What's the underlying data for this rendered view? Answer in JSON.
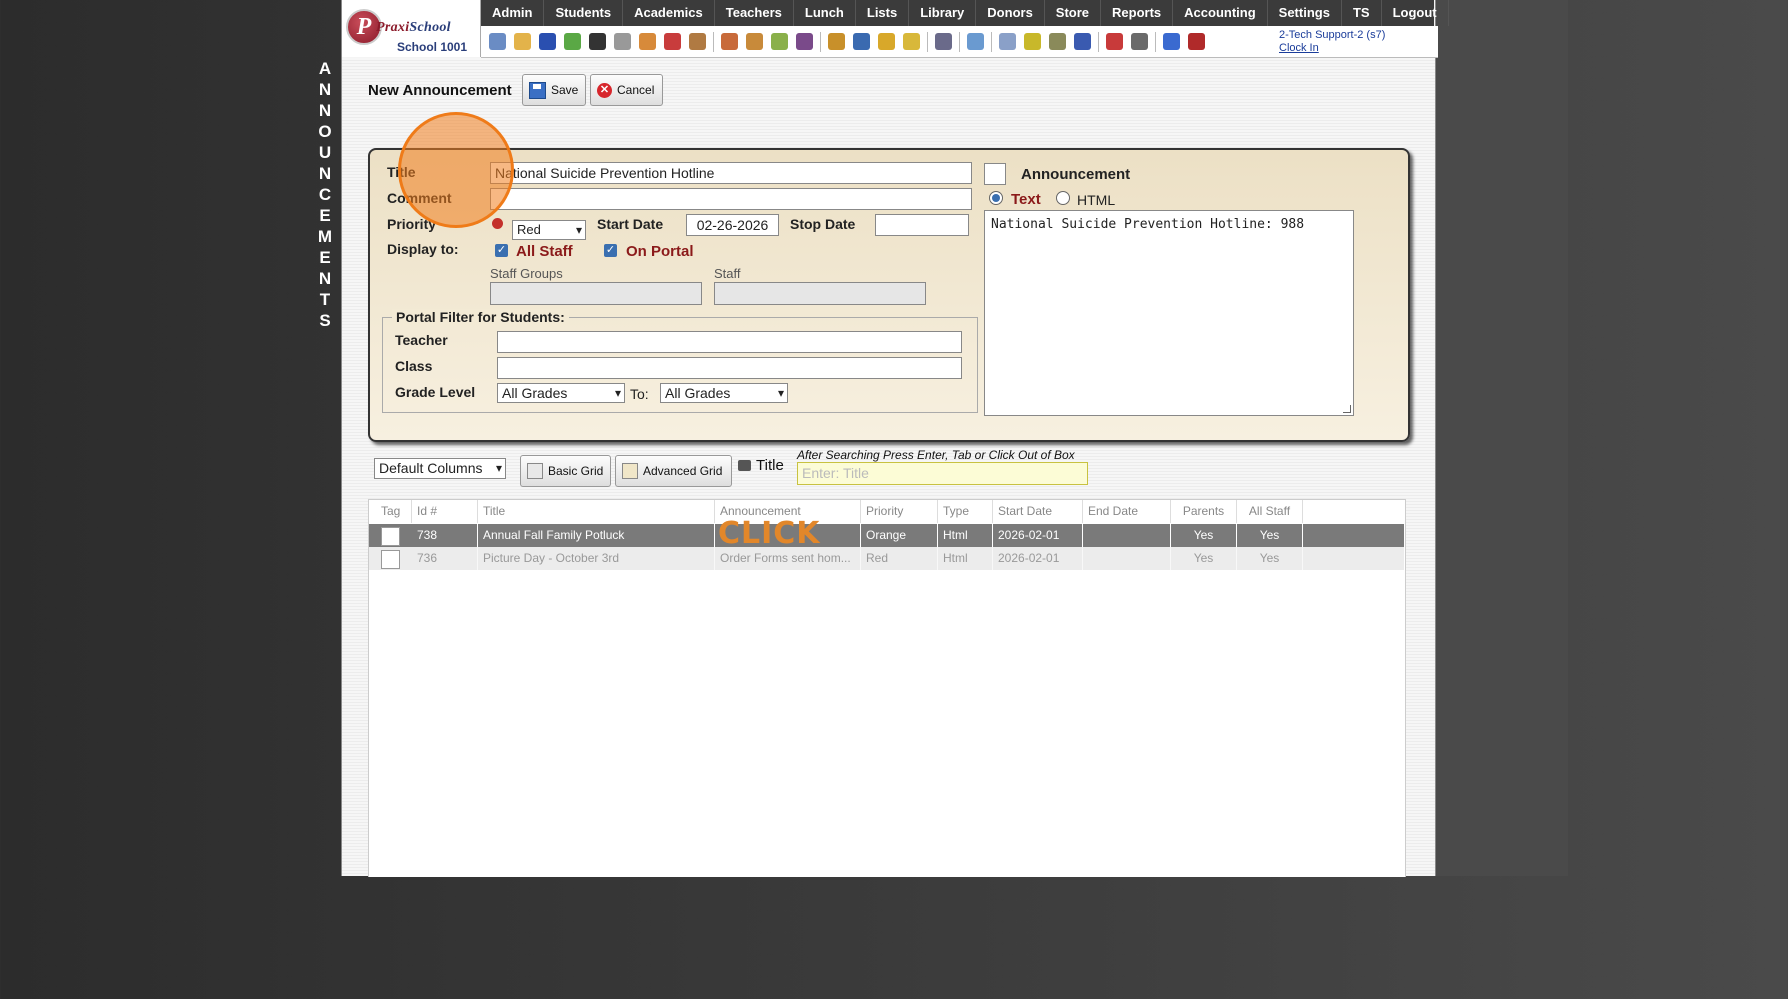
{
  "side_title": [
    "A",
    "N",
    "N",
    "O",
    "U",
    "N",
    "C",
    "E",
    "M",
    "E",
    "N",
    "T",
    "S"
  ],
  "logo": {
    "brand_main": "Praxi",
    "brand_sub": "School",
    "school": "School 1001"
  },
  "menu": [
    "Admin",
    "Students",
    "Academics",
    "Teachers",
    "Lunch",
    "Lists",
    "Library",
    "Donors",
    "Store",
    "Reports",
    "Accounting",
    "Settings",
    "TS",
    "Logout"
  ],
  "toolbar_icons": [
    {
      "name": "search-icon",
      "color": "#6a8cc4"
    },
    {
      "name": "calendar-grid-icon",
      "color": "#e3b34a"
    },
    {
      "name": "email-icon",
      "color": "#2a4fb0"
    },
    {
      "name": "chat-icon",
      "color": "#5aa845"
    },
    {
      "name": "mobile-icon",
      "color": "#333333"
    },
    {
      "name": "speaker-icon",
      "color": "#999999"
    },
    {
      "name": "schedule-icon",
      "color": "#d78a3a"
    },
    {
      "name": "calendar-icon",
      "color": "#c83c3c"
    },
    {
      "name": "megaphone-icon",
      "color": "#b07a42"
    },
    {
      "name": "teacher-icon",
      "color": "#c86a3a"
    },
    {
      "name": "student-icon",
      "color": "#c88a3a"
    },
    {
      "name": "pencil-icon",
      "color": "#8ab04a"
    },
    {
      "name": "users-icon",
      "color": "#7a4a8a"
    },
    {
      "name": "lunch-icon",
      "color": "#c8902a"
    },
    {
      "name": "book-icon",
      "color": "#3a6ab0"
    },
    {
      "name": "bell-icon",
      "color": "#d8a82a"
    },
    {
      "name": "folder-icon",
      "color": "#d8b83a"
    },
    {
      "name": "person-icon",
      "color": "#6a6a8a"
    },
    {
      "name": "clock-icon",
      "color": "#6a9ad0"
    },
    {
      "name": "document-icon",
      "color": "#8aa0c8"
    },
    {
      "name": "card-icon",
      "color": "#c8b82a"
    },
    {
      "name": "printer-icon",
      "color": "#8a8a5a"
    },
    {
      "name": "ap-icon",
      "color": "#3a5ab0"
    },
    {
      "name": "pdf-icon",
      "color": "#c83a3a"
    },
    {
      "name": "cash-register-icon",
      "color": "#6a6a6a"
    },
    {
      "name": "help-icon",
      "color": "#3a6ad0"
    },
    {
      "name": "power-icon",
      "color": "#b02a2a"
    }
  ],
  "user": {
    "name": "2-Tech Support-2 (s7)",
    "clock_in": "Clock In"
  },
  "page_title": "New Announcement",
  "buttons": {
    "save": "Save",
    "cancel": "Cancel"
  },
  "form": {
    "title_label": "Title",
    "title_value": "National Suicide Prevention Hotline",
    "comment_label": "Comment",
    "comment_value": "",
    "priority_label": "Priority",
    "priority_value": "Red",
    "start_date_label": "Start Date",
    "start_date_value": "02-26-2026",
    "stop_date_label": "Stop Date",
    "stop_date_value": "",
    "display_to_label": "Display to:",
    "all_staff_label": "All Staff",
    "on_portal_label": "On Portal",
    "staff_groups_label": "Staff Groups",
    "staff_label": "Staff",
    "portal_filter_legend": "Portal Filter for Students:",
    "teacher_label": "Teacher",
    "class_label": "Class",
    "grade_level_label": "Grade Level",
    "grade_from": "All Grades",
    "to_label": "To:",
    "grade_to": "All Grades",
    "announcement_label": "Announcement",
    "text_label": "Text",
    "html_label": "HTML",
    "announcement_text": "National Suicide Prevention Hotline: 988"
  },
  "grid_controls": {
    "columns_select": "Default Columns",
    "basic_grid": "Basic Grid",
    "advanced_grid": "Advanced Grid",
    "search_label": "Title",
    "search_hint": "After Searching Press Enter, Tab or Click Out of Box",
    "search_placeholder": "Enter: Title"
  },
  "grid": {
    "columns": [
      "Tag",
      "Id #",
      "Title",
      "Announcement",
      "Priority",
      "Type",
      "Start Date",
      "End Date",
      "Parents",
      "All Staff"
    ],
    "rows": [
      {
        "id": "738",
        "title": "Annual Fall Family Potluck",
        "announcement": "",
        "priority": "Orange",
        "type": "Html",
        "start": "2026-02-01",
        "end": "",
        "parents": "Yes",
        "all_staff": "Yes"
      },
      {
        "id": "736",
        "title": "Picture Day - October 3rd",
        "announcement": "Order Forms sent hom...",
        "priority": "Red",
        "type": "Html",
        "start": "2026-02-01",
        "end": "",
        "parents": "Yes",
        "all_staff": "Yes"
      }
    ]
  },
  "overlay_text": "CLICK",
  "colors": {
    "menubar": "#3b3b3b",
    "form_panel": "#ece0c5",
    "selected_row": "#7a7a7a",
    "click_highlight": "#e2872a",
    "search_box": "#fcfcd6"
  }
}
